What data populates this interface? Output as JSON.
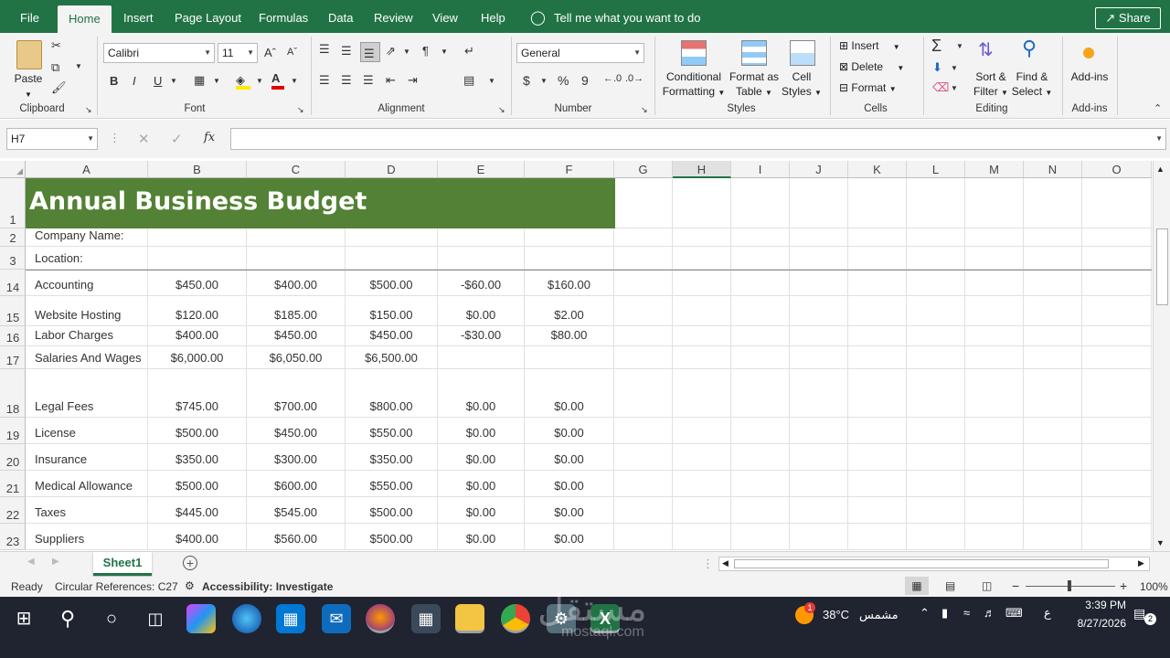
{
  "menu": {
    "tabs": [
      "File",
      "Home",
      "Insert",
      "Page Layout",
      "Formulas",
      "Data",
      "Review",
      "View",
      "Help"
    ],
    "active_tab": "Home",
    "tell_me": "Tell me what you want to do",
    "share": "Share"
  },
  "ribbon": {
    "clipboard": {
      "paste": "Paste",
      "label": "Clipboard"
    },
    "font": {
      "name": "Calibri",
      "size": "11",
      "label": "Font",
      "bold": "B",
      "italic": "I",
      "underline": "U"
    },
    "alignment": {
      "label": "Alignment"
    },
    "number": {
      "format": "General",
      "label": "Number",
      "currency": "$",
      "percent": "%",
      "comma": "9"
    },
    "styles": {
      "conditional_1": "Conditional",
      "conditional_2": "Formatting",
      "format_table_1": "Format as",
      "format_table_2": "Table",
      "cell_styles_1": "Cell",
      "cell_styles_2": "Styles",
      "label": "Styles"
    },
    "cells": {
      "insert": "Insert",
      "delete": "Delete",
      "format": "Format",
      "label": "Cells"
    },
    "editing": {
      "sort_1": "Sort &",
      "sort_2": "Filter",
      "find_1": "Find &",
      "find_2": "Select",
      "label": "Editing"
    },
    "addins": {
      "button": "Add-ins",
      "label": "Add-ins"
    }
  },
  "formula_bar": {
    "name_box": "H7",
    "fx": "fx",
    "value": ""
  },
  "columns": [
    "A",
    "B",
    "C",
    "D",
    "E",
    "F",
    "G",
    "H",
    "I",
    "J",
    "K",
    "L",
    "M",
    "N",
    "O"
  ],
  "sheet": {
    "title": "Annual Business Budget",
    "rows": [
      {
        "num": "1",
        "label": "",
        "values": []
      },
      {
        "num": "2",
        "label": "Company Name:",
        "values": []
      },
      {
        "num": "3",
        "label": "Location:",
        "values": []
      },
      {
        "num": "14",
        "label": "Accounting",
        "values": [
          "$450.00",
          "$400.00",
          "$500.00",
          "-$60.00",
          "$160.00"
        ]
      },
      {
        "num": "15",
        "label": "Website Hosting",
        "values": [
          "$120.00",
          "$185.00",
          "$150.00",
          "$0.00",
          "$2.00"
        ]
      },
      {
        "num": "16",
        "label": "Labor Charges",
        "values": [
          "$400.00",
          "$450.00",
          "$450.00",
          "-$30.00",
          "$80.00"
        ]
      },
      {
        "num": "17",
        "label": "Salaries And Wages",
        "values": [
          "$6,000.00",
          "$6,050.00",
          "$6,500.00",
          "",
          ""
        ]
      },
      {
        "num": "18",
        "label": "Legal Fees",
        "values": [
          "$745.00",
          "$700.00",
          "$800.00",
          "$0.00",
          "$0.00"
        ]
      },
      {
        "num": "19",
        "label": "License",
        "values": [
          "$500.00",
          "$450.00",
          "$550.00",
          "$0.00",
          "$0.00"
        ]
      },
      {
        "num": "20",
        "label": "Insurance",
        "values": [
          "$350.00",
          "$300.00",
          "$350.00",
          "$0.00",
          "$0.00"
        ]
      },
      {
        "num": "21",
        "label": "Medical Allowance",
        "values": [
          "$500.00",
          "$600.00",
          "$550.00",
          "$0.00",
          "$0.00"
        ]
      },
      {
        "num": "22",
        "label": "Taxes",
        "values": [
          "$445.00",
          "$545.00",
          "$500.00",
          "$0.00",
          "$0.00"
        ]
      },
      {
        "num": "23",
        "label": "Suppliers",
        "values": [
          "$400.00",
          "$560.00",
          "$500.00",
          "$0.00",
          "$0.00"
        ]
      }
    ]
  },
  "sheet_tabs": {
    "active": "Sheet1"
  },
  "status": {
    "ready": "Ready",
    "circular": "Circular References: C27",
    "accessibility": "Accessibility: Investigate",
    "zoom": "100%"
  },
  "taskbar": {
    "weather_temp": "38°C",
    "weather_city": "مشمس",
    "weather_badge": "1",
    "lang": "ع",
    "time": "3:39 PM",
    "date": "8/27/2026",
    "notif_count": "2",
    "watermark": "مستقل",
    "watermark_sub": "mostaql.com"
  },
  "colors": {
    "excel_green": "#217346",
    "title_fill": "#538135"
  }
}
